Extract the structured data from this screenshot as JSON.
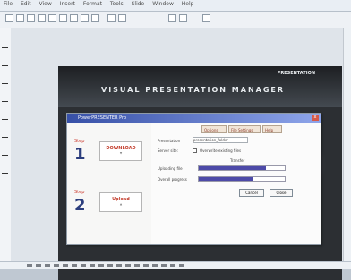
{
  "app": {
    "menu_items": [
      "File",
      "Edit",
      "View",
      "Insert",
      "Format",
      "Tools",
      "Slide",
      "Window",
      "Help"
    ]
  },
  "slide": {
    "brand": "PRESENTATION",
    "title": "VISUAL PRESENTATION MANAGER"
  },
  "dialog": {
    "title": "PowerPRESENTER Pro",
    "left": {
      "step1_label": "Step",
      "step1_number": "1",
      "step1_button": "DOWNLOAD",
      "step2_label": "Step",
      "step2_number": "2",
      "step2_button": "Upload"
    },
    "tabs": [
      "Options",
      "File Settings",
      "Help"
    ],
    "fields": {
      "row1_label": "Presentation",
      "row1_value": "presentation_folder",
      "row2_label": "Server site:",
      "row2_value": "Overwrite existing files",
      "section_label": "Transfer",
      "progress1_label": "Uploading file",
      "progress1_value": 0.78,
      "progress2_label": "Overall progress",
      "progress2_value": 0.64
    },
    "buttons": {
      "cancel": "Cancel",
      "close": "Close"
    }
  }
}
